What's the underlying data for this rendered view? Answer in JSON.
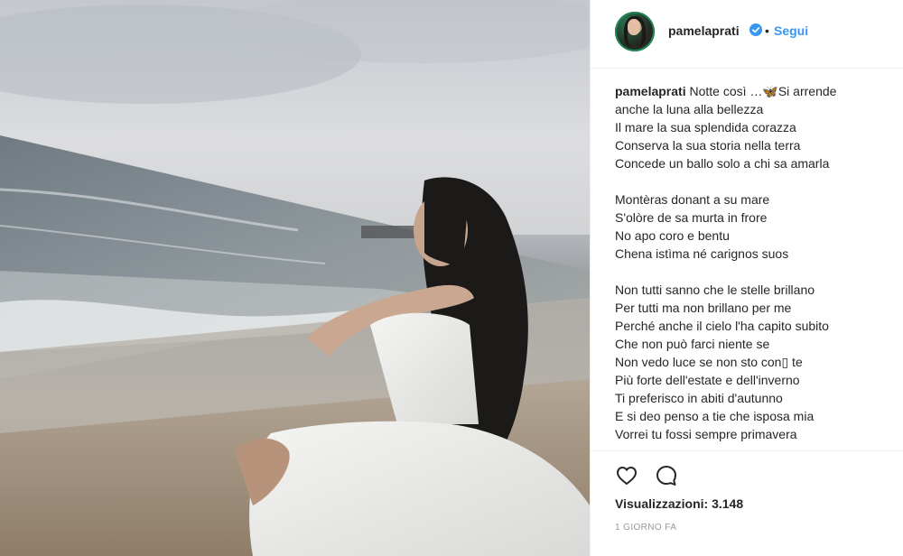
{
  "media": {
    "alt_icon": "video-frame-woman-on-beach"
  },
  "header": {
    "username": "pamelaprati",
    "verified_icon": "verified-badge-icon",
    "separator": "•",
    "follow_label": "Segui"
  },
  "caption": {
    "username": "pamelaprati",
    "lines": [
      "Notte così …🦋Si arrende",
      "anche la luna alla bellezza",
      "Il mare la sua splendida corazza",
      "Conserva la sua storia nella terra",
      "Concede un ballo solo a chi sa amarla",
      "",
      "Montèras donant a su mare",
      "S'olòre de sa murta in frore",
      "No apo coro e bentu",
      "Chena istìma né carignos suos",
      "",
      "Non tutti sanno che le stelle brillano",
      "Per tutti ma non brillano per me",
      "Perché anche il cielo l'ha capito subito",
      "Che non può farci niente se",
      "Non vedo luce se non sto con▯ te",
      "Più forte dell'estate e dell'inverno",
      "Ti preferisco in abiti d'autunno",
      "E si deo penso a tie che isposa mia",
      "Vorrei tu fossi sempre primavera"
    ]
  },
  "actions": {
    "like_icon": "heart-outline-icon",
    "comment_icon": "comment-bubble-icon",
    "views_text": "Visualizzazioni: 3.148",
    "time_text": "1 GIORNO FA"
  },
  "colors": {
    "follow": "#3897f0",
    "verified": "#3897f0",
    "text": "#262626",
    "muted": "#999999",
    "border": "#efefef"
  }
}
